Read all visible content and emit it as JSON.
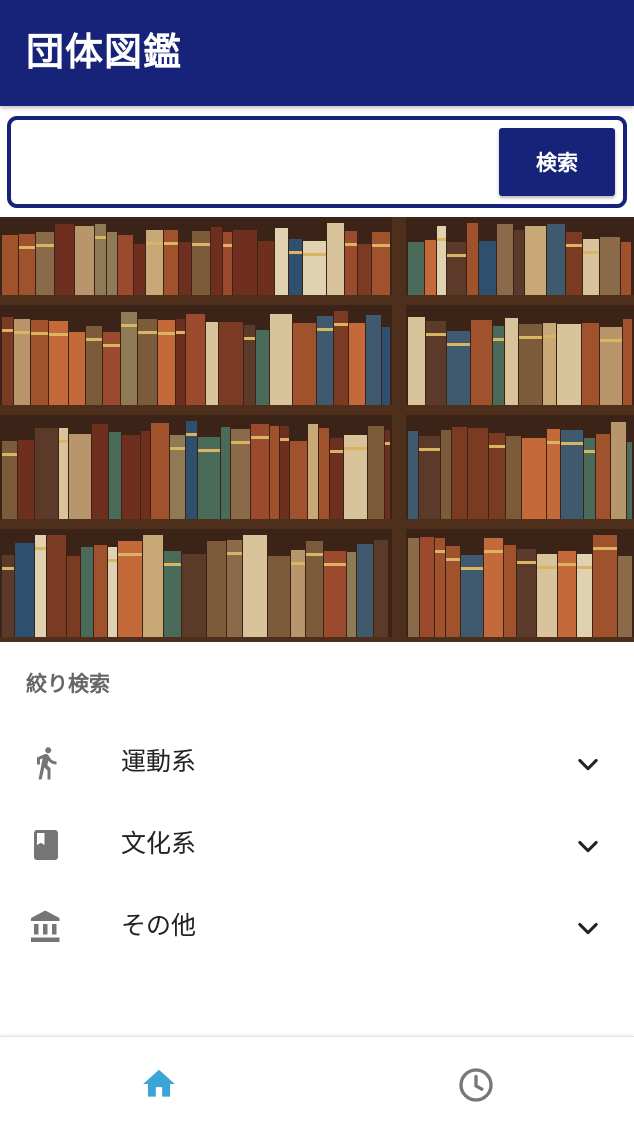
{
  "header": {
    "title": "団体図鑑",
    "background_color": "#172379"
  },
  "search": {
    "value": "",
    "placeholder": "",
    "button_label": "検索"
  },
  "hero": {
    "image_subject": "bookshelf-photo"
  },
  "filter": {
    "title": "絞り検索",
    "categories": [
      {
        "label": "運動系",
        "icon": "running-person-icon"
      },
      {
        "label": "文化系",
        "icon": "book-icon"
      },
      {
        "label": "その他",
        "icon": "institution-icon"
      }
    ]
  },
  "bottom_nav": {
    "items": [
      {
        "icon": "home-icon",
        "active": true,
        "color": "#3aa5d6"
      },
      {
        "icon": "history-clock-icon",
        "active": false,
        "color": "#777777"
      }
    ]
  }
}
